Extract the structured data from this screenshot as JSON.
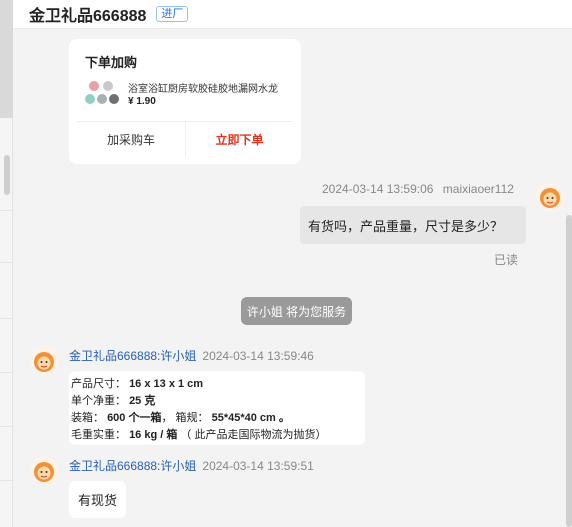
{
  "header": {
    "shop_title": "金卫礼品666888",
    "tag": "进厂"
  },
  "order_card": {
    "title": "下单加购",
    "product_name": "浴室浴缸厨房软胶硅胶地漏网水龙",
    "price": "¥ 1.90",
    "add_cart_label": "加采购车",
    "buy_now_label": "立即下单"
  },
  "outgoing": {
    "time": "2024-03-14 13:59:06",
    "user": "maixiaoer112",
    "text": "有货吗，产品重量，尺寸是多少？",
    "status": "已读"
  },
  "notice": "许小姐 将为您服务",
  "incoming": [
    {
      "sender": "金卫礼品666888:许小姐",
      "time": "2024-03-14 13:59:46",
      "spec": {
        "size_label": "产品尺寸：",
        "size_value": "16 x 13 x 1 cm",
        "weight_label": "单个净重：",
        "weight_value": "25 克",
        "box_label": "装箱：",
        "box_count": "600 个一箱",
        "box_sep": "，",
        "box_spec_label": "箱规：",
        "box_spec_value": "55*45*40 cm",
        "box_end": "。",
        "gross_label": "毛重实重：",
        "gross_value": "16 kg / 箱",
        "gross_note": "（ 此产品走国际物流为抛货）"
      }
    },
    {
      "sender": "金卫礼品666888:许小姐",
      "time": "2024-03-14 13:59:51",
      "text": "有现货"
    }
  ],
  "icons": {
    "avatar": "cartoon-lion-icon",
    "product": "drain-strainer-thumbnail"
  },
  "colors": {
    "accent_blue": "#2a5fb0",
    "buy_red": "#e0351b",
    "notice_gray": "#9a9a9a"
  }
}
